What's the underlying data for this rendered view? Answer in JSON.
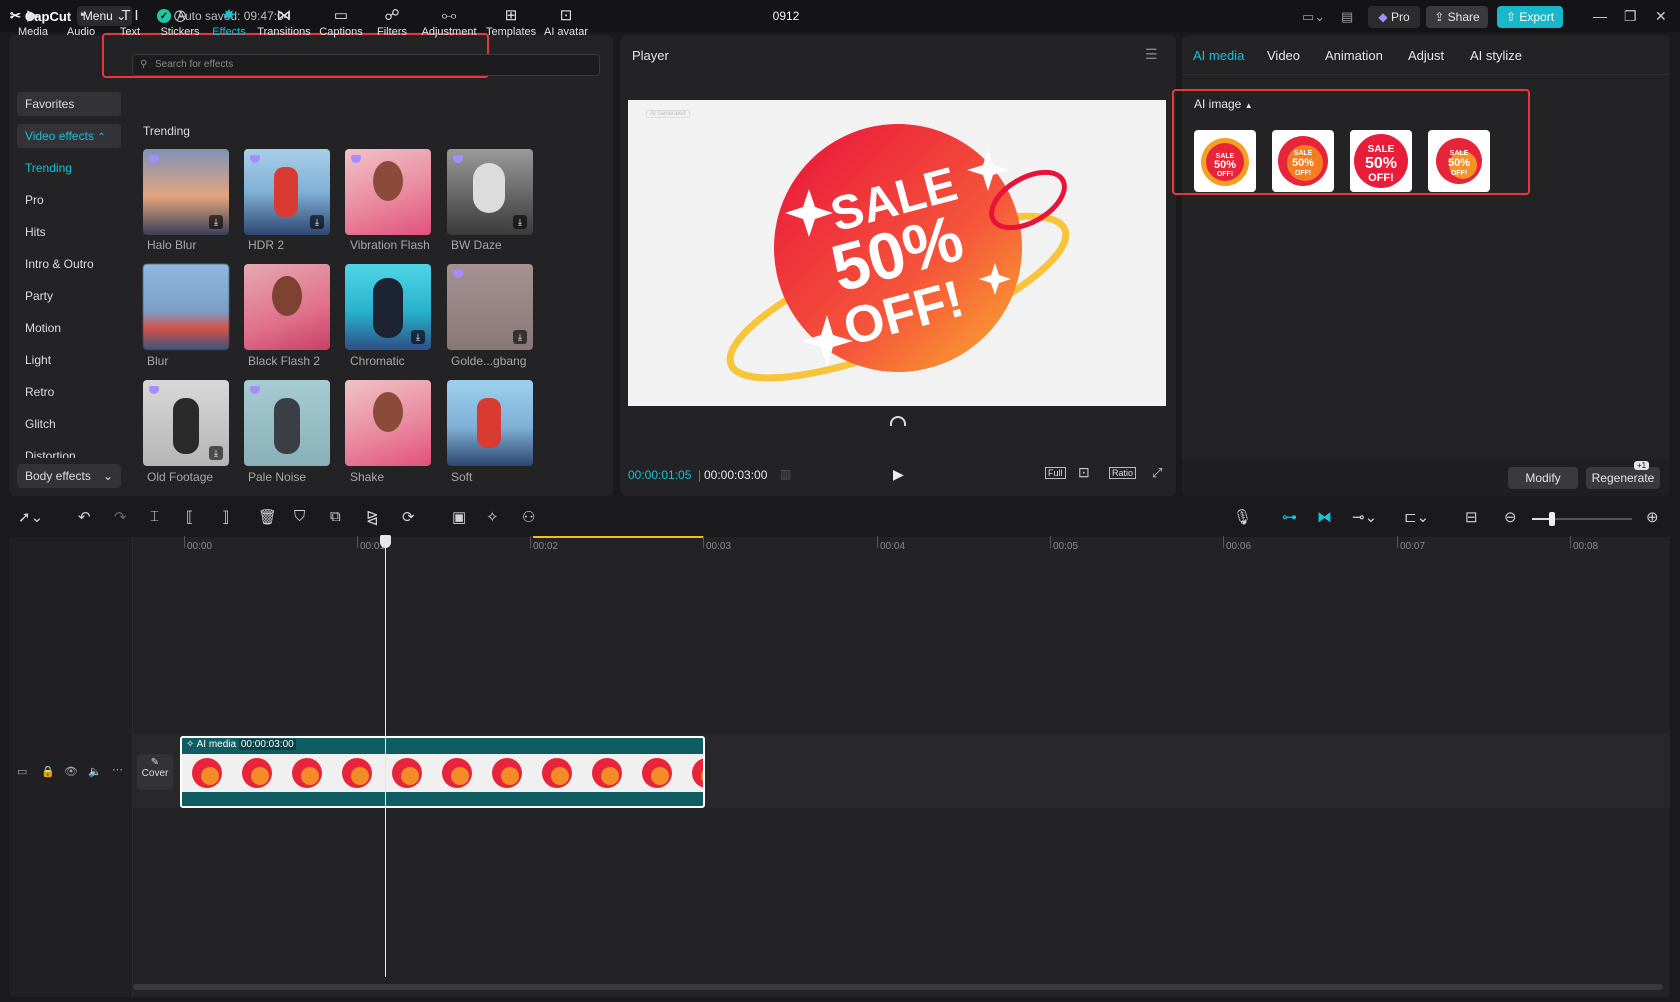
{
  "titlebar": {
    "logo": "CapCut",
    "menu": "Menu",
    "autosave": "Auto saved: 09:47:04",
    "project_title": "0912",
    "pro": "Pro",
    "share": "Share",
    "export": "Export"
  },
  "toptabs": [
    {
      "label": "Media",
      "icon": "media-icon"
    },
    {
      "label": "Audio",
      "icon": "audio-icon"
    },
    {
      "label": "Text",
      "icon": "text-icon"
    },
    {
      "label": "Stickers",
      "icon": "stickers-icon"
    },
    {
      "label": "Effects",
      "icon": "effects-icon"
    },
    {
      "label": "Transitions",
      "icon": "transitions-icon"
    },
    {
      "label": "Captions",
      "icon": "captions-icon"
    },
    {
      "label": "Filters",
      "icon": "filters-icon"
    },
    {
      "label": "Adjustment",
      "icon": "adjustment-icon"
    },
    {
      "label": "Templates",
      "icon": "templates-icon"
    },
    {
      "label": "AI avatar",
      "icon": "ai-avatar-icon"
    }
  ],
  "sidebar": {
    "favorites": "Favorites",
    "video_effects": "Video effects",
    "items": [
      "Trending",
      "Pro",
      "Hits",
      "Intro & Outro",
      "Party",
      "Motion",
      "Light",
      "Retro",
      "Glitch",
      "Distortion"
    ],
    "body_effects": "Body effects"
  },
  "effects": {
    "search_placeholder": "Search for effects",
    "section": "Trending",
    "items": [
      "Halo Blur",
      "HDR 2",
      "Vibration Flash",
      "BW Daze",
      "Blur",
      "Black Flash 2",
      "Chromatic",
      "Golde...gbang",
      "Old Footage",
      "Pale Noise",
      "Shake",
      "Soft"
    ]
  },
  "player": {
    "title": "Player",
    "time_current": "00:00:01:05",
    "time_total": "00:00:03:00",
    "full": "Full",
    "ratio": "Ratio",
    "canvas_text": {
      "sale": "SALE",
      "pct": "50%",
      "off": "OFF!"
    },
    "watermark": "AI Generated"
  },
  "right": {
    "tabs": [
      "AI media",
      "Video",
      "Animation",
      "Adjust",
      "AI stylize"
    ],
    "ai_image": "AI image",
    "modify": "Modify",
    "regenerate": "Regenerate",
    "badge": "+1"
  },
  "timeline": {
    "ticks": [
      "00:00",
      "00:01",
      "00:02",
      "00:03",
      "00:04",
      "00:05",
      "00:06",
      "00:07",
      "00:08"
    ],
    "clip_label": "AI media",
    "clip_duration": "00:00:03:00",
    "cover": "Cover",
    "sticker_text": {
      "sale": "SALE",
      "pct": "50%",
      "off": "OFF!"
    }
  },
  "colors": {
    "accent": "#19c1d4",
    "highlight_box": "#e8363c"
  }
}
